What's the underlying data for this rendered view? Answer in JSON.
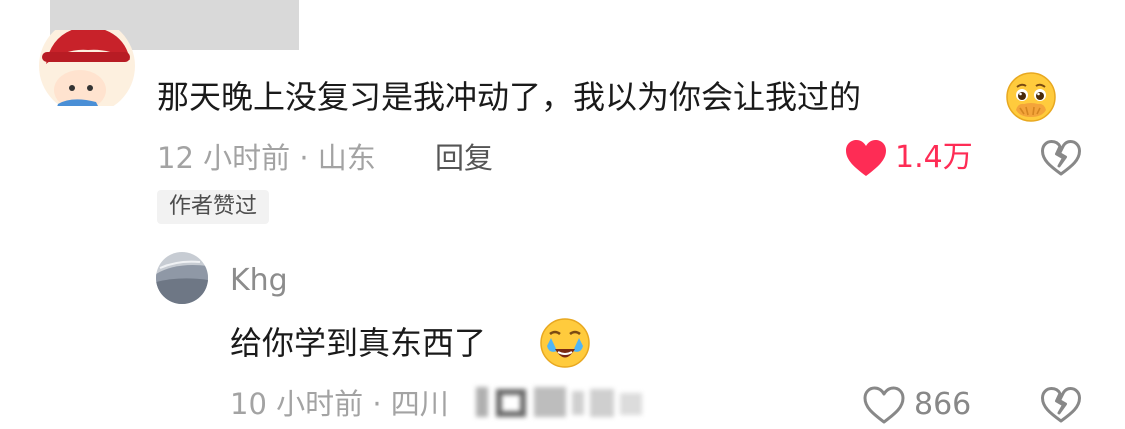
{
  "main_comment": {
    "text": "那天晚上没复习是我冲动了，我以为你会让我过的",
    "emoji": "pleading-face-hands-over-mouth",
    "meta": "12 小时前 · 山东",
    "reply_label": "回复",
    "like_count": "1.4万",
    "liked": true,
    "author_badge": "作者赞过"
  },
  "reply_comment": {
    "username": "Khg",
    "text": "给你学到真东西了",
    "emoji": "crying-face",
    "meta": "10 小时前 · 四川",
    "like_count": "866",
    "liked": false
  },
  "colors": {
    "like_active": "#fe2c55",
    "meta": "#a3a3a3",
    "text": "#1a1a1a",
    "icon_outline": "#888888"
  }
}
